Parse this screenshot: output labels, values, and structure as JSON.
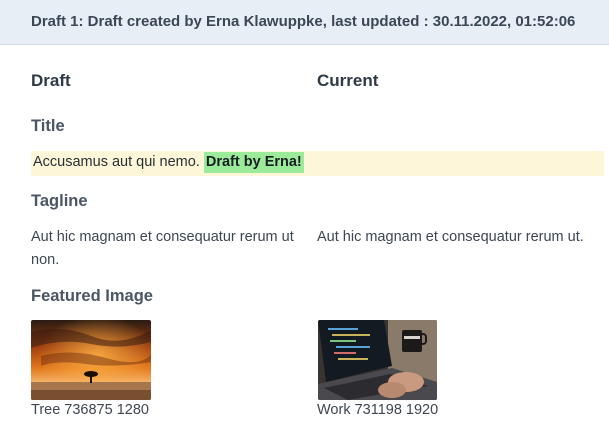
{
  "header": {
    "text": "Draft 1: Draft created by Erna Klawuppke, last updated : 30.11.2022, 01:52:06"
  },
  "columns": {
    "draft_label": "Draft",
    "current_label": "Current"
  },
  "sections": {
    "title_label": "Title",
    "tagline_label": "Tagline",
    "image_label": "Featured Image"
  },
  "title_diff": {
    "common": "Accusamus aut qui nemo.",
    "added": "Draft by Erna!"
  },
  "tagline": {
    "draft": "Aut hic magnam et consequatur rerum ut non.",
    "current": "Aut hic magnam et consequatur rerum ut."
  },
  "images": {
    "draft": {
      "caption": "Tree 736875 1280",
      "icon": "sunset-tree-photo"
    },
    "current": {
      "caption": "Work 731198 1920",
      "icon": "laptop-coding-photo"
    }
  },
  "colors": {
    "header_bg": "#e8eef6",
    "diff_changed_bg": "#fdf6d8",
    "diff_added_bg": "#9ceb9a"
  }
}
